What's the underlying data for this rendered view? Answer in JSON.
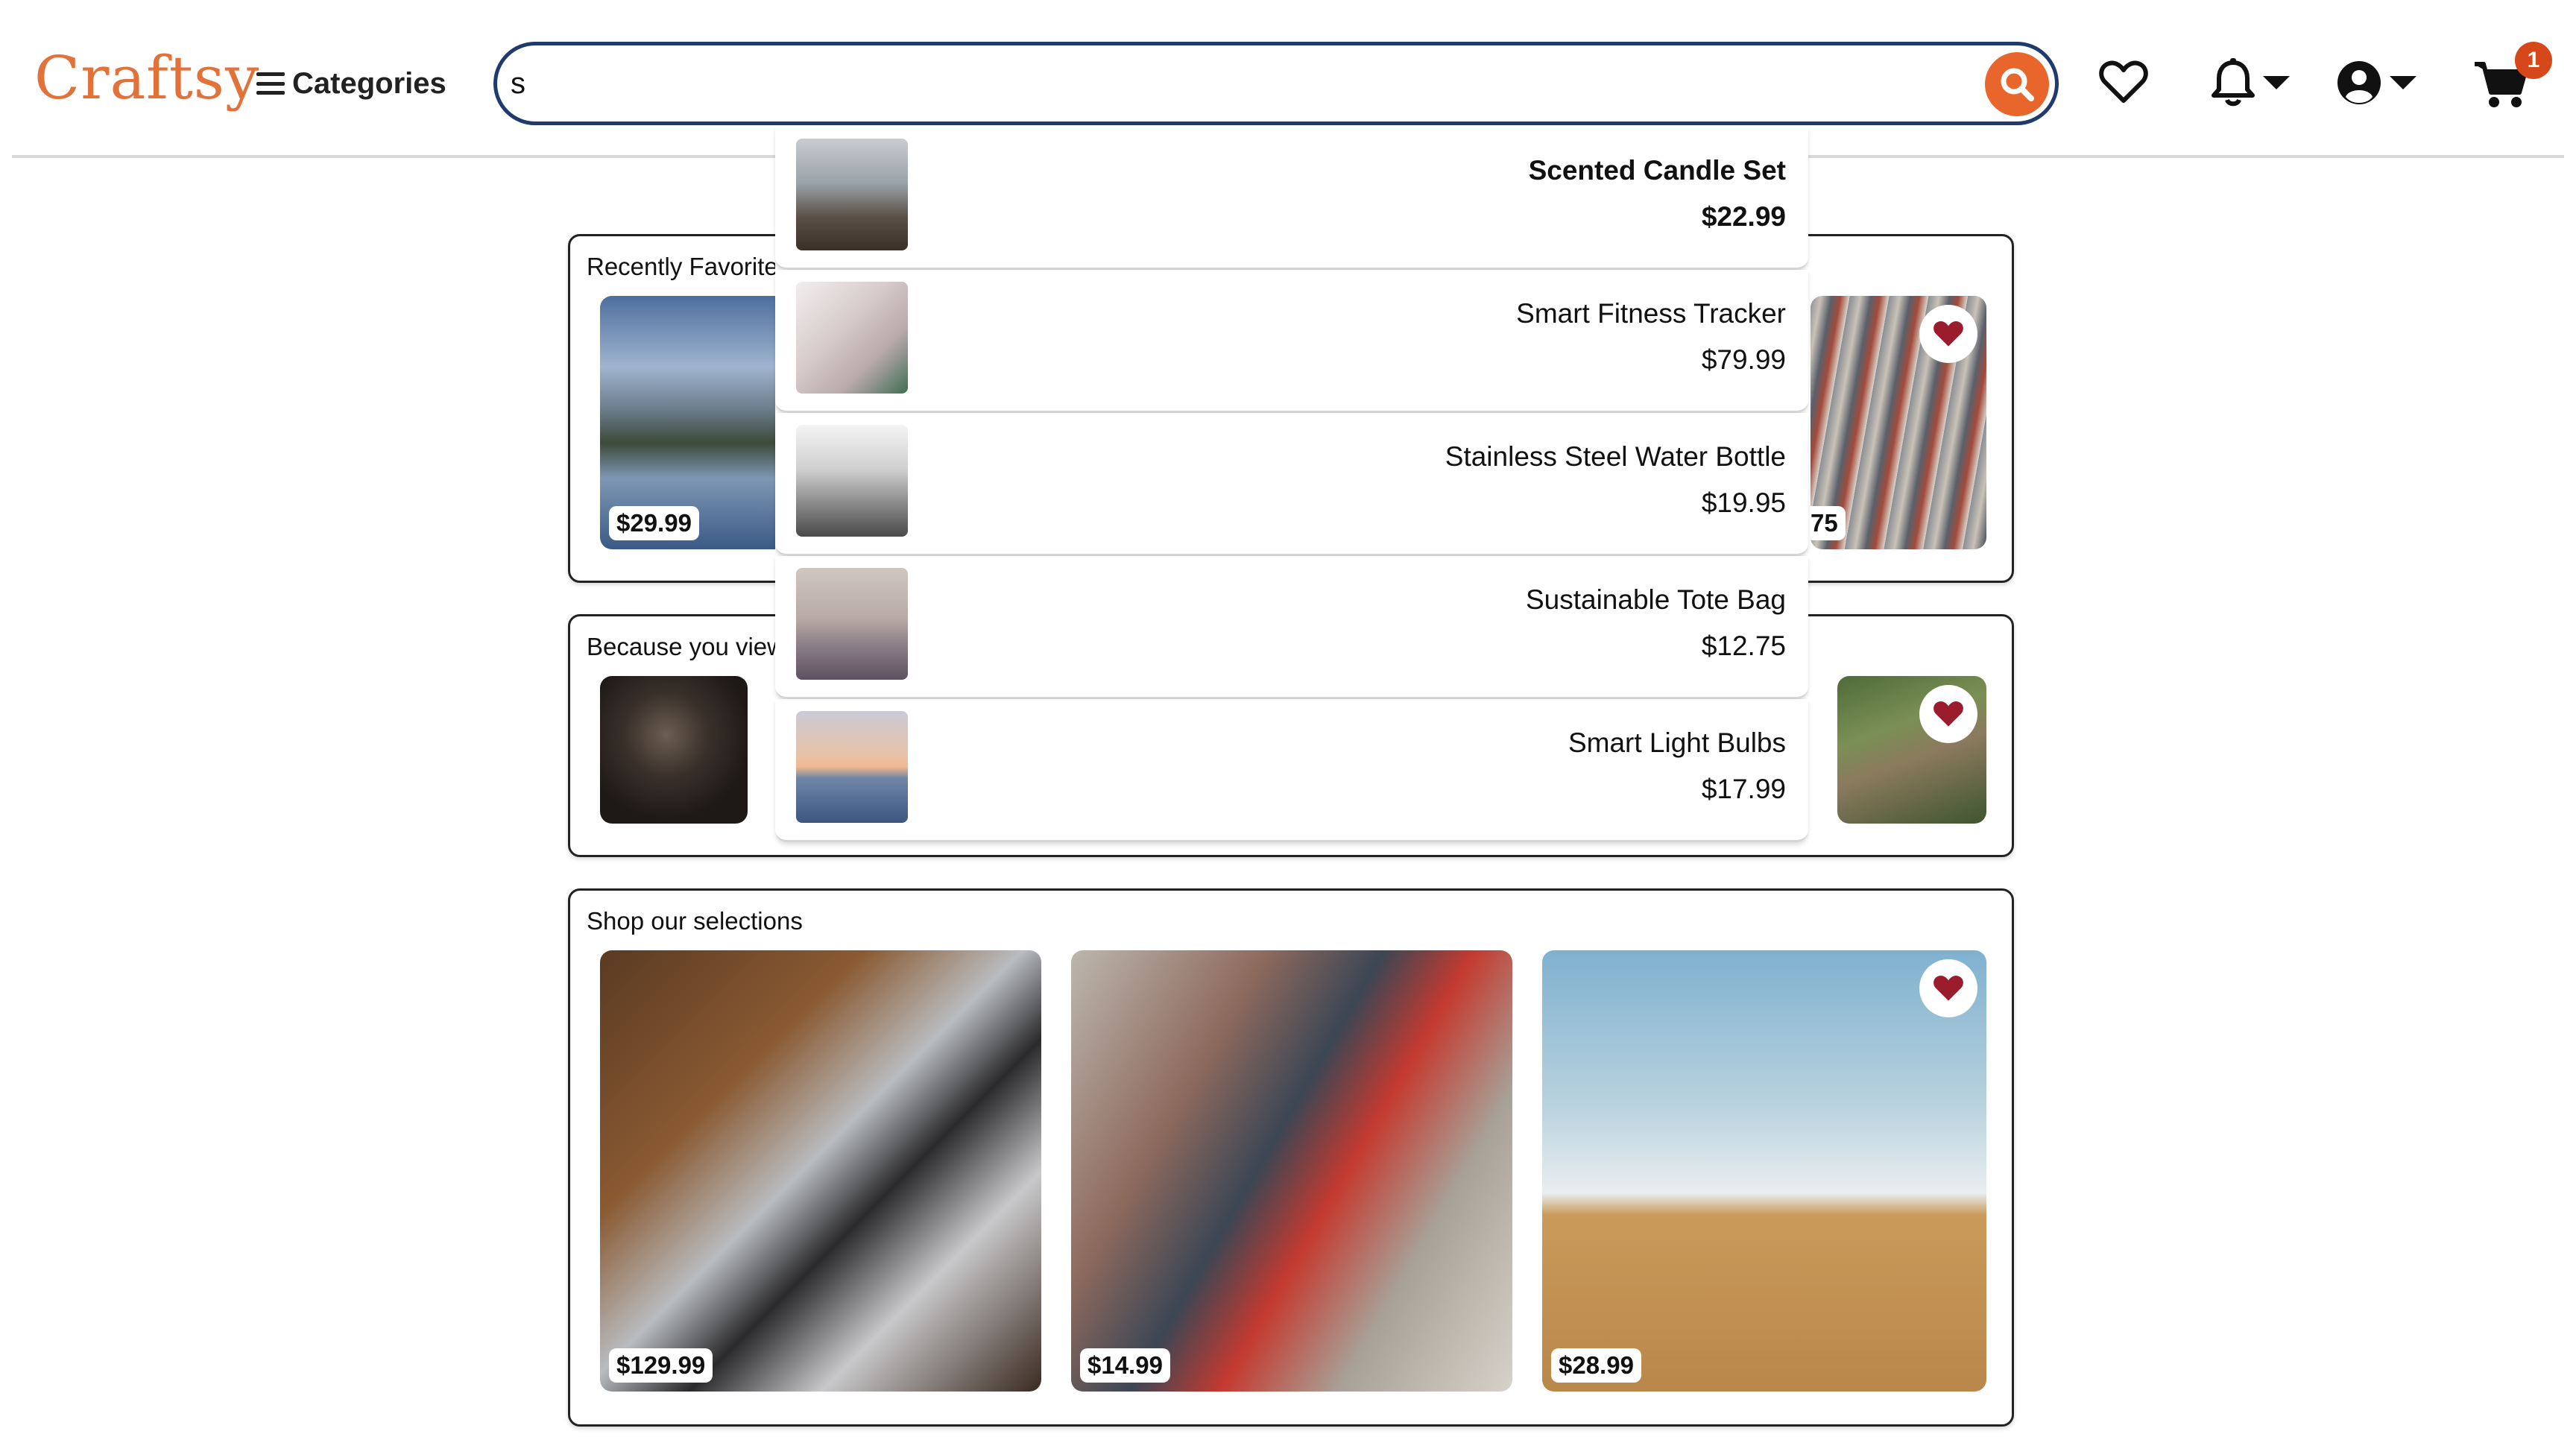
{
  "header": {
    "logo": "Craftsy",
    "categories_label": "Categories",
    "search_value": "s",
    "search_placeholder": "",
    "cart_count": "1"
  },
  "suggestions": [
    {
      "name": "Scented Candle Set",
      "price": "$22.99"
    },
    {
      "name": "Smart Fitness Tracker",
      "price": "$79.99"
    },
    {
      "name": "Stainless Steel Water Bottle",
      "price": "$19.95"
    },
    {
      "name": "Sustainable Tote Bag",
      "price": "$12.75"
    },
    {
      "name": "Smart Light Bulbs",
      "price": "$17.99"
    }
  ],
  "recently_favorited": {
    "title": "Recently Favorited",
    "first_price": "$29.99",
    "last_price_fragment": "75"
  },
  "because_you_viewed": {
    "title": "Because you view"
  },
  "shop_selections": {
    "title": "Shop our selections",
    "items": [
      {
        "price": "$129.99"
      },
      {
        "price": "$14.99"
      },
      {
        "price": "$28.99"
      }
    ]
  },
  "colors": {
    "brand": "#e0723a",
    "search_border": "#1f3a6d",
    "search_button": "#e8662c",
    "favorite_heart": "#9b1c2c",
    "badge": "#d6481a"
  },
  "icons": {
    "search": "search-icon",
    "wishlist": "heart-outline-icon",
    "notifications": "bell-icon",
    "account": "user-circle-icon",
    "cart": "shopping-cart-icon",
    "favorite": "heart-filled-icon"
  }
}
